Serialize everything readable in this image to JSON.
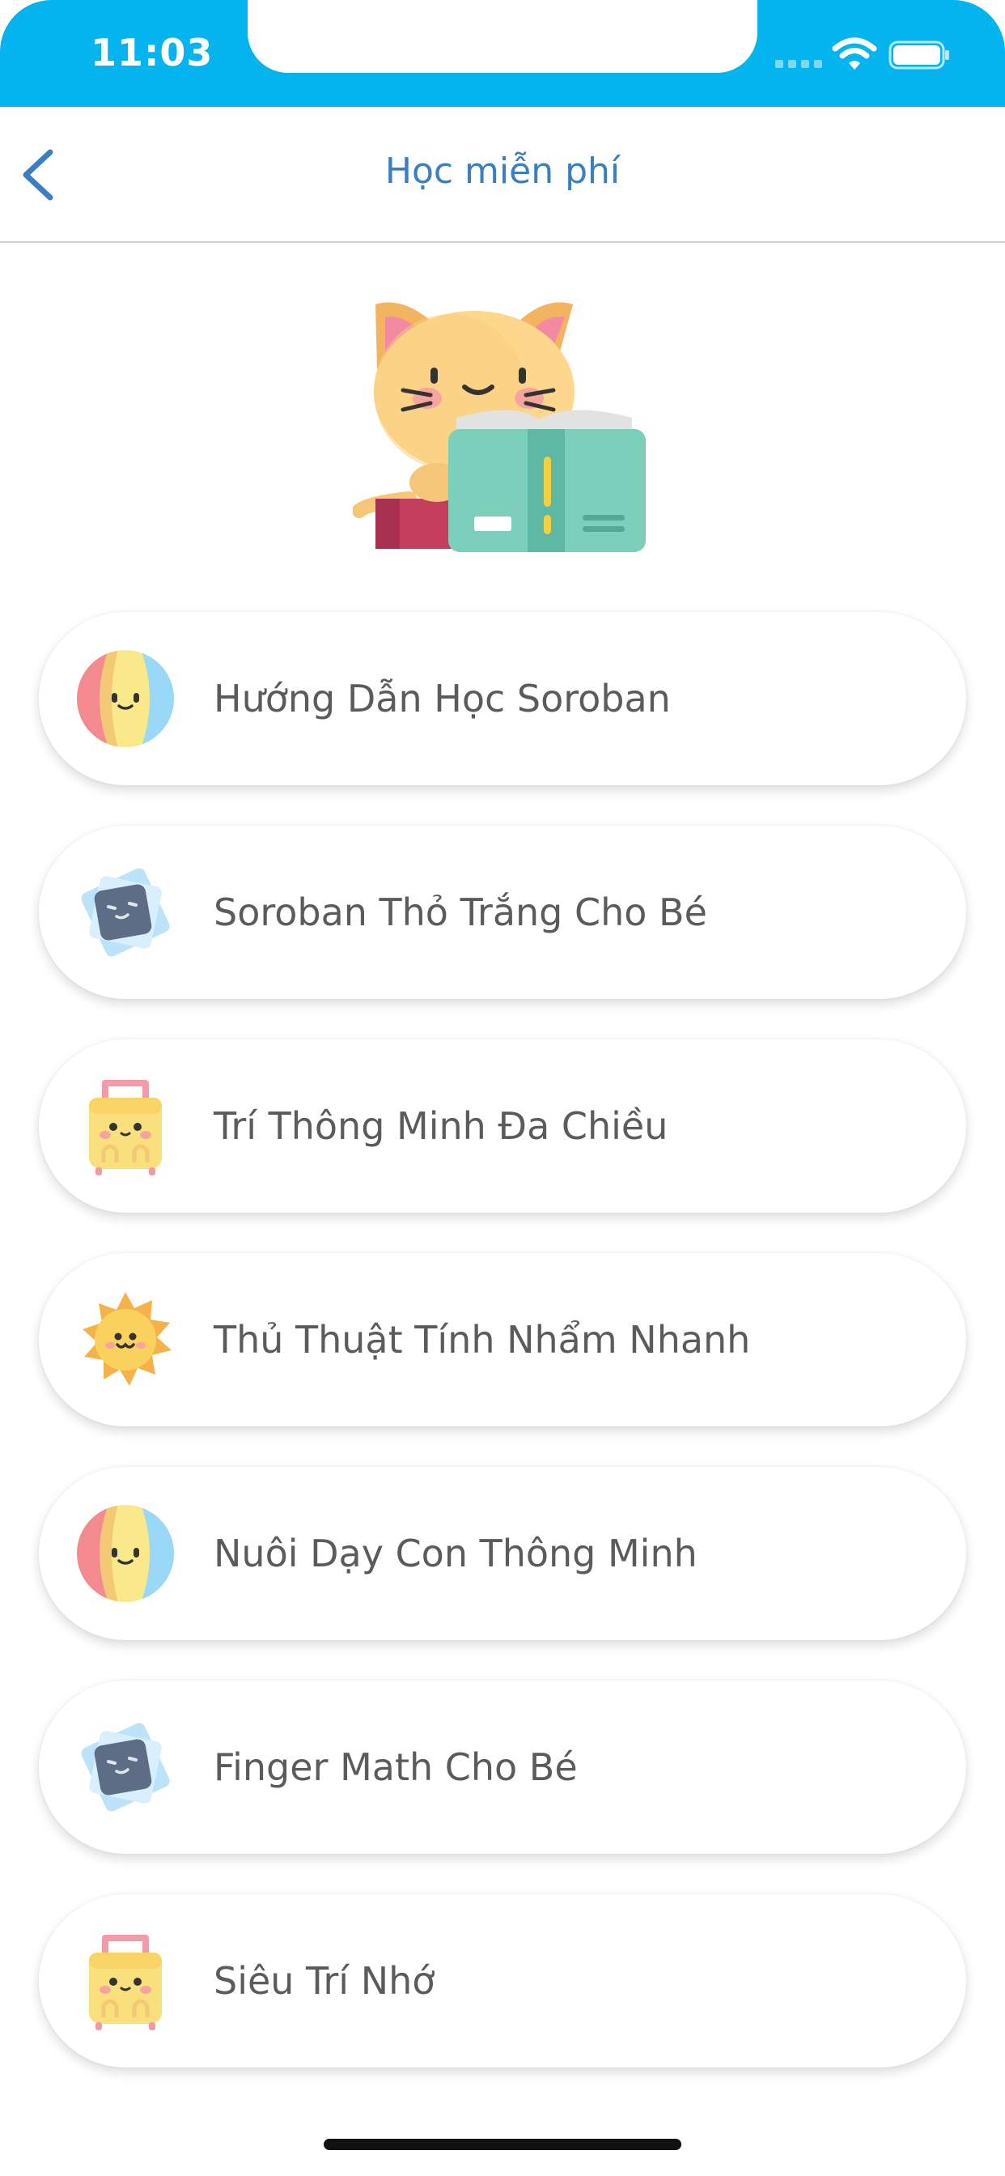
{
  "status_bar": {
    "time": "11:03",
    "color": "#04b4ef"
  },
  "nav": {
    "back_icon": "chevron-left-icon",
    "title": "Học miễn phí",
    "title_color": "#3a7fc1"
  },
  "hero": {
    "icon": "cat-reading-book-illustration"
  },
  "items": [
    {
      "label": "Hướng Dẫn Học Soroban",
      "icon": "beach-ball-icon"
    },
    {
      "label": "Soroban Thỏ Trắng Cho Bé",
      "icon": "blue-card-face-icon"
    },
    {
      "label": "Trí Thông Minh Đa Chiều",
      "icon": "yellow-suitcase-icon"
    },
    {
      "label": "Thủ Thuật Tính Nhẩm Nhanh",
      "icon": "sun-face-icon"
    },
    {
      "label": "Nuôi Dạy Con Thông Minh",
      "icon": "beach-ball-icon"
    },
    {
      "label": "Finger Math Cho Bé",
      "icon": "blue-card-face-icon"
    },
    {
      "label": "Siêu Trí Nhớ",
      "icon": "yellow-suitcase-icon"
    }
  ]
}
